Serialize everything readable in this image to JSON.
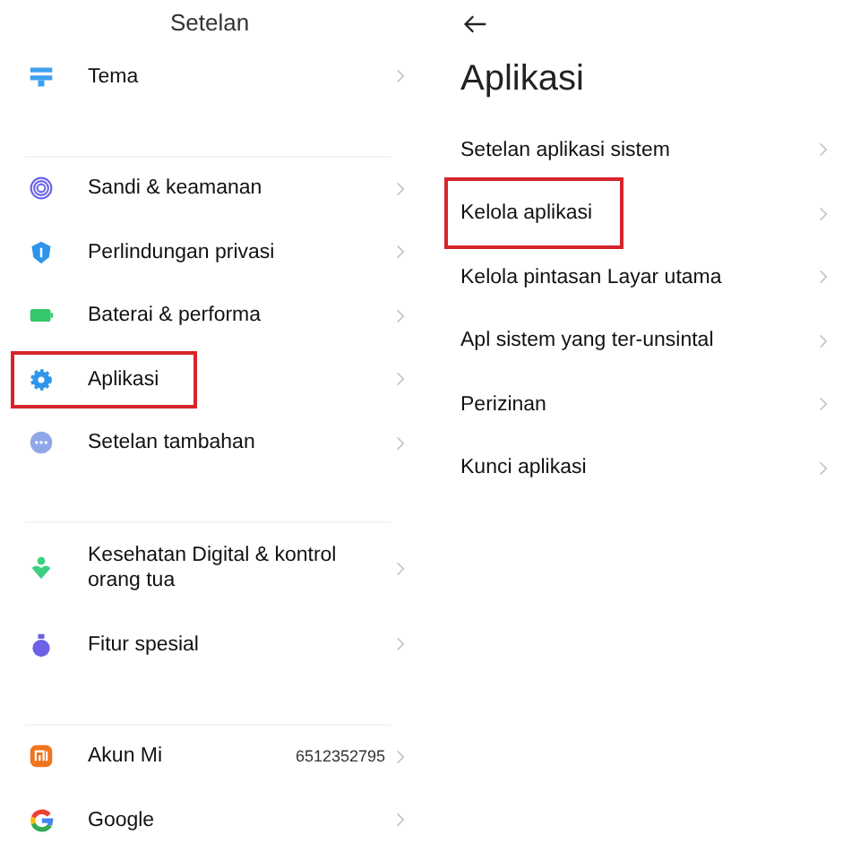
{
  "left": {
    "title": "Setelan",
    "groups": [
      {
        "items": [
          {
            "label": "Tema",
            "highlighted": false
          }
        ]
      },
      {
        "items": [
          {
            "label": "Sandi & keamanan",
            "highlighted": false
          },
          {
            "label": "Perlindungan privasi",
            "highlighted": false
          },
          {
            "label": "Baterai & performa",
            "highlighted": false
          },
          {
            "label": "Aplikasi",
            "highlighted": true
          },
          {
            "label": "Setelan tambahan",
            "highlighted": false
          }
        ]
      },
      {
        "items": [
          {
            "label": "Kesehatan Digital & kontrol orang tua",
            "highlighted": false
          },
          {
            "label": "Fitur spesial",
            "highlighted": false
          }
        ]
      },
      {
        "items": [
          {
            "label": "Akun Mi",
            "value": "6512352795",
            "highlighted": false
          },
          {
            "label": "Google",
            "highlighted": false
          }
        ]
      }
    ]
  },
  "right": {
    "title": "Aplikasi",
    "items": [
      {
        "label": "Setelan aplikasi sistem",
        "highlighted": false
      },
      {
        "label": "Kelola aplikasi",
        "highlighted": true
      },
      {
        "label": "Kelola pintasan Layar utama",
        "highlighted": false
      },
      {
        "label": "Apl sistem yang ter-unsintal",
        "highlighted": false
      },
      {
        "label": "Perizinan",
        "highlighted": false
      },
      {
        "label": "Kunci aplikasi",
        "highlighted": false
      }
    ]
  }
}
